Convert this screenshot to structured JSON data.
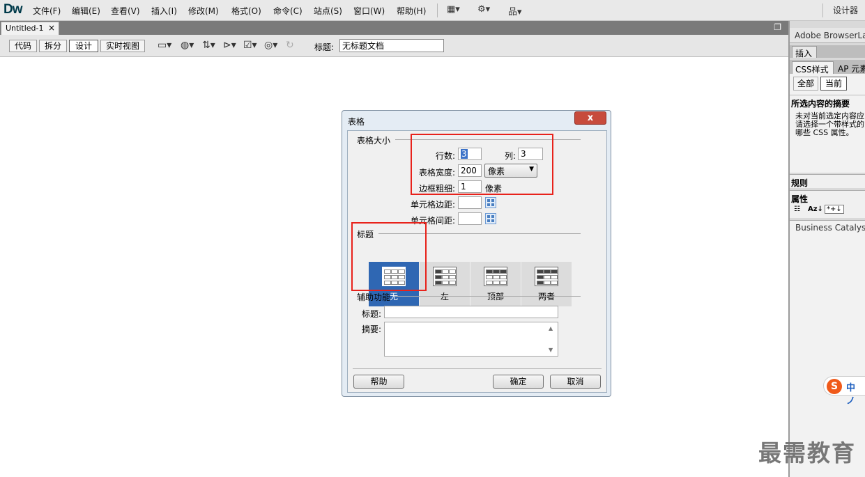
{
  "app": {
    "logo": "Dw",
    "designer": "设计器"
  },
  "menu": [
    "文件(F)",
    "编辑(E)",
    "查看(V)",
    "插入(I)",
    "修改(M)",
    "格式(O)",
    "命令(C)",
    "站点(S)",
    "窗口(W)",
    "帮助(H)"
  ],
  "toolbar_icons": [
    "layout-icon",
    "gear-icon",
    "site-icon"
  ],
  "document": {
    "tab_name": "Untitled-1",
    "close_glyph": "×",
    "view_buttons": [
      "代码",
      "拆分",
      "设计",
      "实时视图"
    ],
    "active_view": "设计",
    "title_label": "标题:",
    "title_value": "无标题文档"
  },
  "right_panel": {
    "browserlab": "Adobe BrowserLab",
    "insert_tab": "插入",
    "css_tab": "CSS样式",
    "ap_tab": "AP 元素",
    "all_btn": "全部",
    "current_btn": "当前",
    "summary_title": "所选内容的摘要",
    "summary_lines": [
      "未对当前选定内容应",
      "请选择一个带样式的",
      "哪些 CSS 属性。"
    ],
    "rules": "规则",
    "properties": "属性",
    "business_catalyst": "Business Catalyst"
  },
  "dialog": {
    "title": "表格",
    "close": "x",
    "size_group": "表格大小",
    "rows_label": "行数:",
    "rows_value": "3",
    "cols_label": "列:",
    "cols_value": "3",
    "width_label": "表格宽度:",
    "width_value": "200",
    "width_unit": "像素",
    "border_label": "边框粗细:",
    "border_value": "1",
    "border_unit": "像素",
    "padding_label": "单元格边距:",
    "padding_value": "",
    "spacing_label": "单元格间距:",
    "spacing_value": "",
    "header_group": "标题",
    "header_options": [
      "无",
      "左",
      "顶部",
      "两者"
    ],
    "selected_header": "无",
    "access_group": "辅助功能",
    "caption_label": "标题:",
    "caption_value": "",
    "summary_label": "摘要:",
    "summary_value": "",
    "help_btn": "帮助",
    "ok_btn": "确定",
    "cancel_btn": "取消"
  },
  "ime": {
    "logo": "S",
    "mode": "中 ノ"
  },
  "watermark": "最需教育",
  "colors": {
    "highlight_red": "#e8221b",
    "selected_blue": "#2f67b3"
  }
}
